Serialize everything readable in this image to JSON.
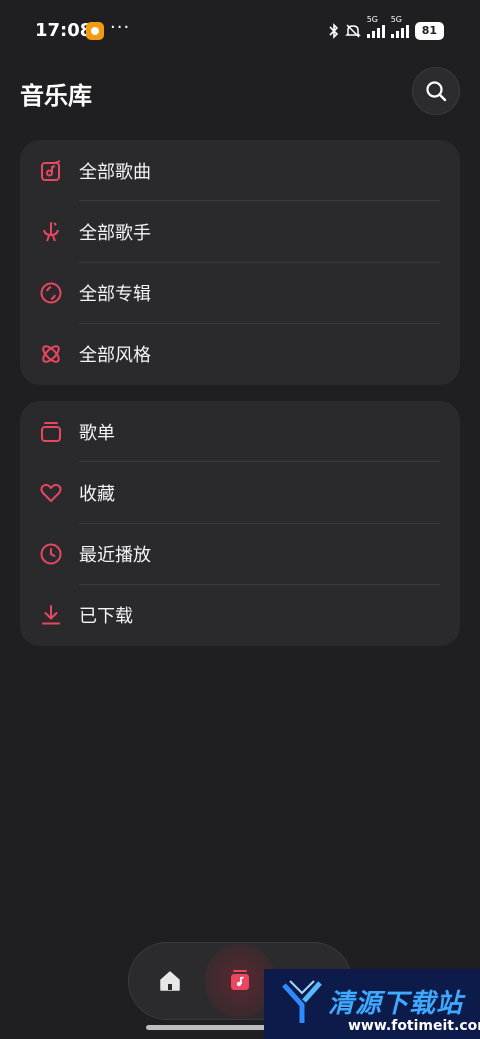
{
  "status_bar": {
    "time": "17:08",
    "more": "···",
    "network_1": "5G",
    "network_2": "5G",
    "battery": "81"
  },
  "header": {
    "title": "音乐库",
    "search_icon": "search-icon"
  },
  "library_categories": [
    {
      "label": "全部歌曲",
      "icon": "songs-icon"
    },
    {
      "label": "全部歌手",
      "icon": "artist-icon"
    },
    {
      "label": "全部专辑",
      "icon": "album-icon"
    },
    {
      "label": "全部风格",
      "icon": "genre-icon"
    }
  ],
  "my_collection": [
    {
      "label": "歌单",
      "icon": "playlist-icon"
    },
    {
      "label": "收藏",
      "icon": "heart-icon"
    },
    {
      "label": "最近播放",
      "icon": "clock-icon"
    },
    {
      "label": "已下载",
      "icon": "download-icon"
    }
  ],
  "bottom_nav": {
    "items": [
      "home-icon",
      "library-icon",
      "profile-icon"
    ],
    "active": "library"
  },
  "watermark": {
    "title": "清源下载站",
    "url": "www.fotimeit.com"
  },
  "colors": {
    "accent": "#e8475f",
    "background": "#1f1f21",
    "card": "#2a2a2d"
  }
}
